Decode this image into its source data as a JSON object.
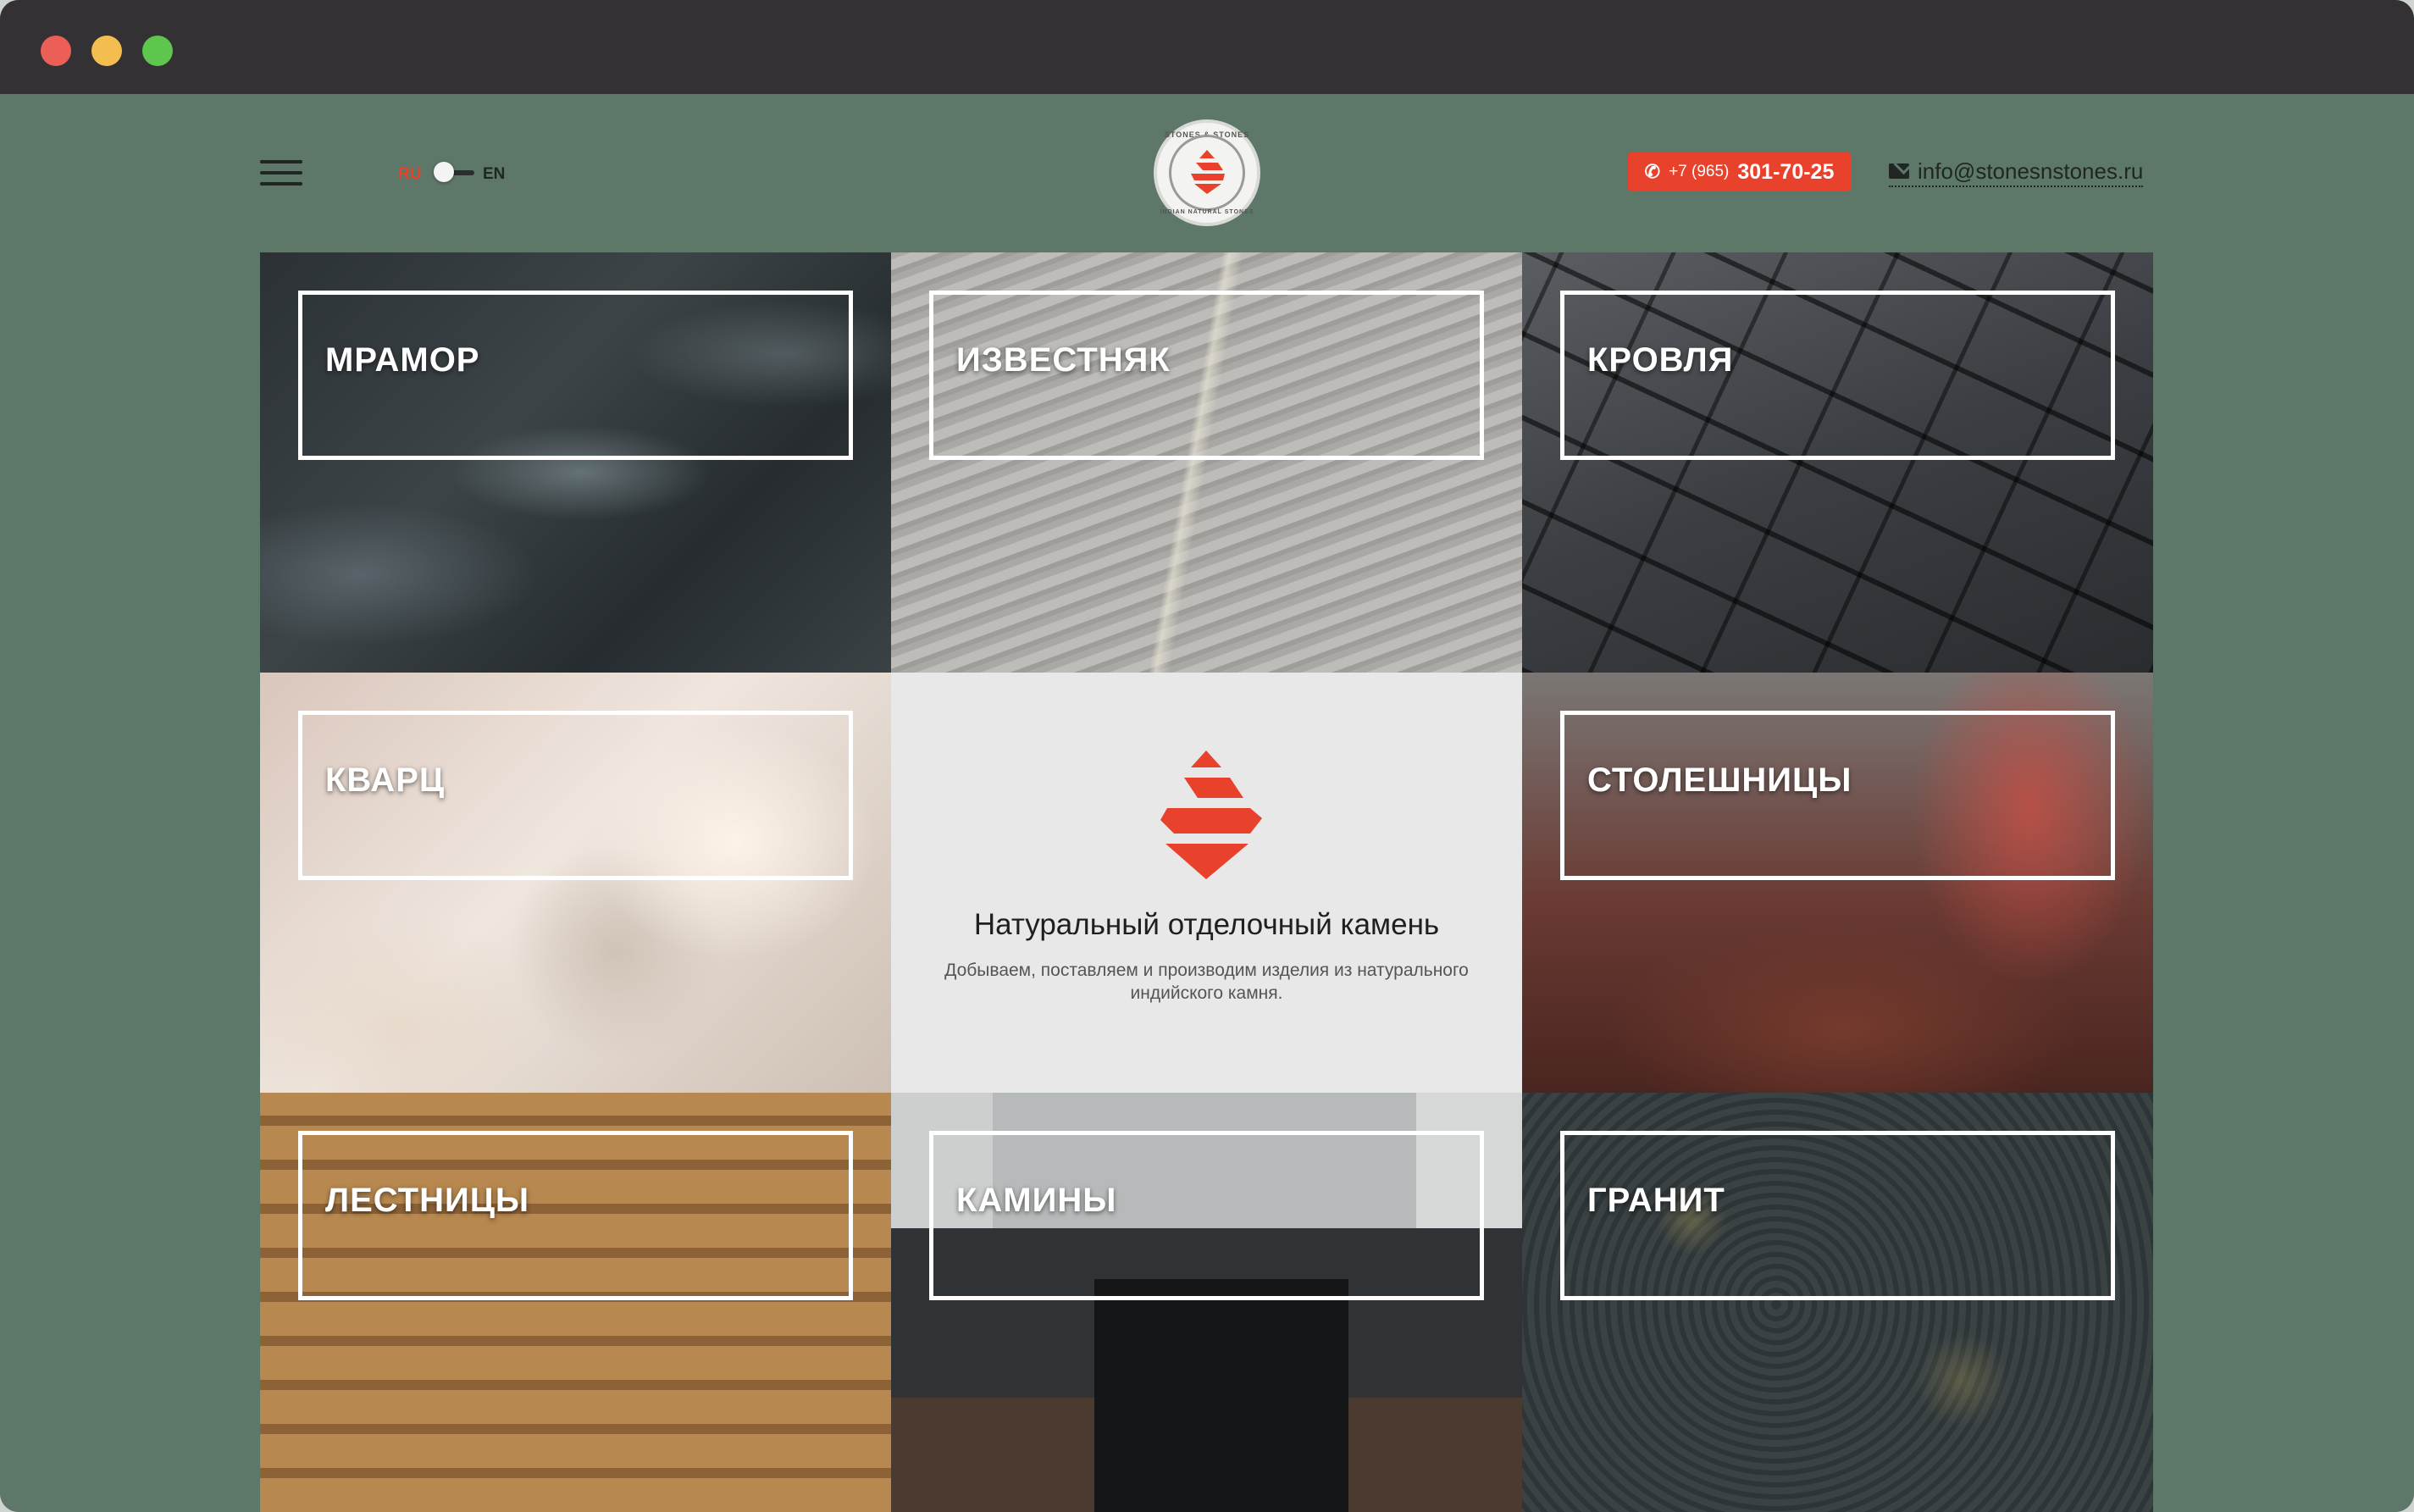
{
  "header": {
    "lang_ru": "RU",
    "lang_en": "EN",
    "logo_text_top": "STONES & STONES",
    "logo_text_bottom": "INDIAN NATURAL STONES",
    "phone_prefix": "+7 (965)",
    "phone_number": "301-70-25",
    "email": "info@stonesnstones.ru"
  },
  "colors": {
    "accent": "#e8412c",
    "background": "#5d7768",
    "titlebar": "#333134"
  },
  "icons": {
    "menu": "hamburger-icon",
    "phone": "phone-icon",
    "email": "mail-icon"
  },
  "tiles": [
    {
      "label": "МРАМОР"
    },
    {
      "label": "ИЗВЕСТНЯК"
    },
    {
      "label": "КРОВЛЯ"
    },
    {
      "label": "КВАРЦ"
    },
    {
      "label": "СТОЛЕШНИЦЫ"
    },
    {
      "label": "ЛЕСТНИЦЫ"
    },
    {
      "label": "КАМИНЫ"
    },
    {
      "label": "ГРАНИТ"
    }
  ],
  "center": {
    "title": "Натуральный отделочный камень",
    "subtitle": "Добываем, поставляем и производим изделия из натурального индийского камня."
  }
}
